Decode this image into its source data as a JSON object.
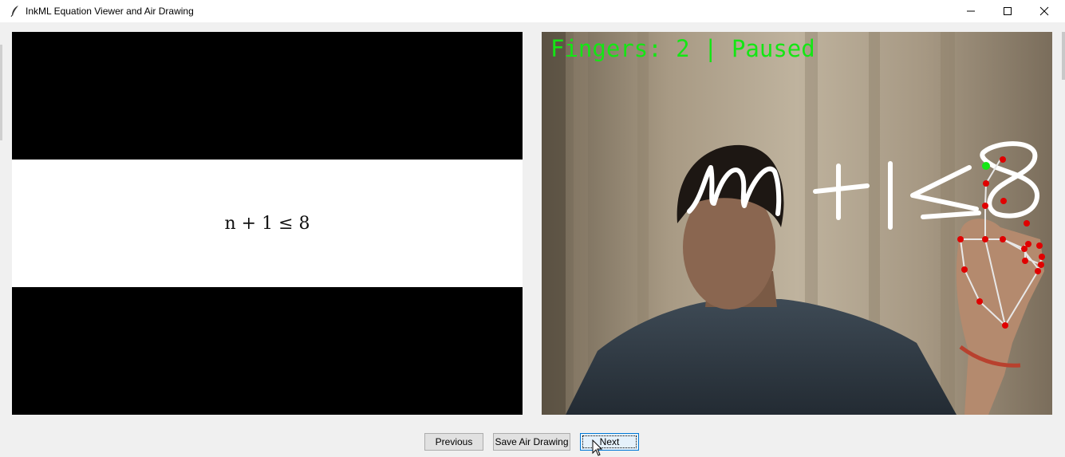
{
  "window": {
    "title": "InkML Equation Viewer and Air Drawing",
    "icon": "feather-icon"
  },
  "equation_panel": {
    "equation": "n + 1 ≤ 8"
  },
  "camera_panel": {
    "status_text": "Fingers: 2 | Paused",
    "status_color": "#14e614",
    "air_drawing_text": "n+1≤8",
    "ink_color": "#ffffff",
    "landmark_color": "#e00000"
  },
  "buttons": {
    "previous": "Previous",
    "save": "Save Air Drawing",
    "next": "Next"
  }
}
